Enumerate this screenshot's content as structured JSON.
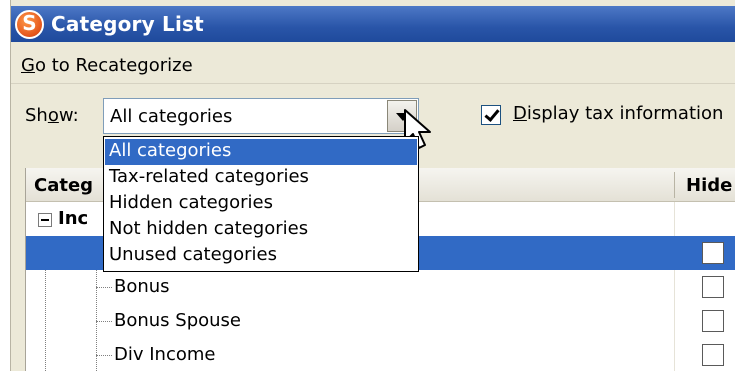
{
  "window": {
    "title": "Category List",
    "icon": "quicken-s-icon"
  },
  "menu": {
    "recategorize_prefix": "G",
    "recategorize_rest": "o to Recategorize"
  },
  "toolbar": {
    "show_label_a": "Sh",
    "show_label_u": "o",
    "show_label_b": "w:",
    "show_value": "All categories",
    "tax_checked": true,
    "tax_label_u": "D",
    "tax_label_rest": "isplay tax information"
  },
  "dropdown_options": [
    "All categories",
    "Tax-related categories",
    "Hidden categories",
    "Not hidden categories",
    "Unused categories"
  ],
  "selected_option_index": 0,
  "table": {
    "header_category": "Categ",
    "header_hide": "Hide",
    "group_label": "Inc",
    "rows": [
      {
        "label": "",
        "selected": true
      },
      {
        "label": "Bonus",
        "selected": false
      },
      {
        "label": "Bonus Spouse",
        "selected": false
      },
      {
        "label": "Div Income",
        "selected": false
      }
    ]
  },
  "colors": {
    "titlebar": "#2955a8",
    "selection": "#316ac5",
    "window_bg": "#ece9d8"
  }
}
